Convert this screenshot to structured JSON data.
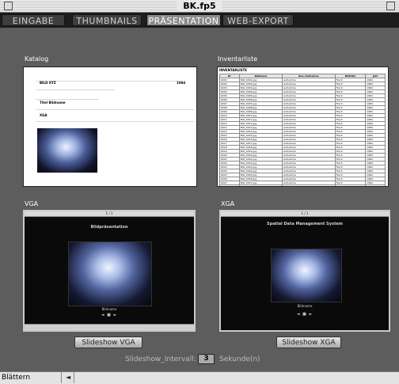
{
  "window": {
    "title": "BK.fp5"
  },
  "tabs": [
    {
      "label": "EINGABE",
      "active": false
    },
    {
      "label": "THUMBNAILS",
      "active": false
    },
    {
      "label": "PRÄSENTATION",
      "active": true
    },
    {
      "label": "WEB-EXPORT",
      "active": false
    }
  ],
  "catalog": {
    "label": "Katalog",
    "lines": [
      "BILD XYZ",
      "",
      "1984",
      "",
      "Titel Bildname",
      "",
      "XGA"
    ]
  },
  "inventory": {
    "label": "Inventarliste",
    "title": "INVENTARLISTE",
    "headers": [
      "Nr",
      "Bildname",
      "Bez./Aufnahme",
      "Bildtitel",
      "Jahr"
    ],
    "rows": [
      [
        "0001",
        "Bild_0001.jpg",
        "Aufnahme",
        "Flach",
        "1984"
      ],
      [
        "0002",
        "Bild_0002.jpg",
        "Aufnahme",
        "Flach",
        "1984"
      ],
      [
        "0003",
        "Bild_0003.jpg",
        "Aufnahme",
        "Flach",
        "1984"
      ],
      [
        "0004",
        "Bild_0004.jpg",
        "Aufnahme",
        "Flach",
        "1984"
      ],
      [
        "0005",
        "Bild_0005.jpg",
        "Aufnahme",
        "Flach",
        "1984"
      ],
      [
        "0006",
        "Bild_0006.jpg",
        "Aufnahme",
        "Flach",
        "1984"
      ],
      [
        "0007",
        "Bild_0007.jpg",
        "Aufnahme",
        "Flach",
        "1984"
      ],
      [
        "0008",
        "Bild_0008.jpg",
        "Aufnahme",
        "Flach",
        "1984"
      ],
      [
        "0009",
        "Bild_0009.jpg",
        "Aufnahme",
        "Flach",
        "1984"
      ],
      [
        "0010",
        "Bild_0010.jpg",
        "Aufnahme",
        "Flach",
        "1984"
      ],
      [
        "0011",
        "Bild_0011.jpg",
        "Aufnahme",
        "Flach",
        "1984"
      ],
      [
        "0012",
        "Bild_0012.jpg",
        "Aufnahme",
        "Flach",
        "1984"
      ],
      [
        "0013",
        "Bild_0013.jpg",
        "Aufnahme",
        "Flach",
        "1984"
      ],
      [
        "0014",
        "Bild_0014.jpg",
        "Aufnahme",
        "Flach",
        "1984"
      ],
      [
        "0015",
        "Bild_0015.jpg",
        "Aufnahme",
        "Flach",
        "1984"
      ],
      [
        "0016",
        "Bild_0016.jpg",
        "Aufnahme",
        "Flach",
        "1984"
      ],
      [
        "0017",
        "Bild_0017.jpg",
        "Aufnahme",
        "Flach",
        "1984"
      ],
      [
        "0018",
        "Bild_0018.jpg",
        "Aufnahme",
        "Flach",
        "1984"
      ],
      [
        "0019",
        "Bild_0019.jpg",
        "Aufnahme",
        "Flach",
        "1984"
      ],
      [
        "0020",
        "Bild_0020.jpg",
        "Aufnahme",
        "Flach",
        "1984"
      ],
      [
        "0021",
        "Bild_0021.jpg",
        "Aufnahme",
        "Flach",
        "1984"
      ],
      [
        "0022",
        "Bild_0022.jpg",
        "Aufnahme",
        "Flach",
        "1984"
      ],
      [
        "0023",
        "Bild_0023.jpg",
        "Aufnahme",
        "Flach",
        "1984"
      ],
      [
        "0024",
        "Bild_0024.jpg",
        "Aufnahme",
        "Flach",
        "1984"
      ],
      [
        "0025",
        "Bild_0025.jpg",
        "Aufnahme",
        "Flach",
        "1984"
      ],
      [
        "0026",
        "Bild_0026.jpg",
        "Aufnahme",
        "Flach",
        "1984"
      ],
      [
        "0027",
        "Bild_0027.jpg",
        "Aufnahme",
        "Flach",
        "1984"
      ],
      [
        "0028",
        "Bild_0028.jpg",
        "Aufnahme",
        "Flach",
        "1984"
      ]
    ]
  },
  "vga": {
    "label": "VGA",
    "header": "1 / 1",
    "heading": "Bildpräsentation",
    "caption": "Bildname",
    "nav": "◄ ■ ►",
    "button": "Slideshow VGA"
  },
  "xga": {
    "label": "XGA",
    "header": "1 / 1",
    "heading": "Spatial Data Management System",
    "caption": "Bildname",
    "nav": "◄ ■ ►",
    "button": "Slideshow XGA"
  },
  "interval": {
    "label": "Slideshow_Intervall:",
    "value": "3",
    "unit": "Sekunde(n)"
  },
  "statusbar": {
    "mode": "Blättern"
  }
}
